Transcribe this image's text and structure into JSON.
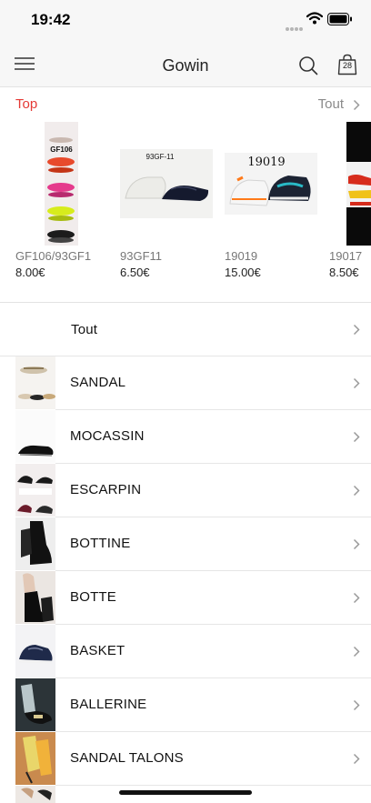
{
  "status_bar": {
    "time": "19:42"
  },
  "nav": {
    "title": "Gowin",
    "bag_count": "28"
  },
  "top_section": {
    "label": "Top",
    "all_label": "Tout"
  },
  "products": [
    {
      "name": "GF106/93GF1",
      "price": "8.00€",
      "image_caption": "GF106"
    },
    {
      "name": "93GF11",
      "price": "6.50€",
      "image_caption": "93GF-11"
    },
    {
      "name": "19019",
      "price": "15.00€",
      "image_caption": "19019"
    },
    {
      "name": "19017",
      "price": "8.50€",
      "image_caption": ""
    }
  ],
  "categories": [
    {
      "label": "Tout"
    },
    {
      "label": "SANDAL"
    },
    {
      "label": "MOCASSIN"
    },
    {
      "label": "ESCARPIN"
    },
    {
      "label": "BOTTINE"
    },
    {
      "label": "BOTTE"
    },
    {
      "label": "BASKET"
    },
    {
      "label": "BALLERINE"
    },
    {
      "label": "SANDAL TALONS"
    }
  ],
  "colors": {
    "accent_red": "#e53935",
    "muted_text": "#8a8a8a",
    "bar_bg": "#f7f7f7"
  }
}
